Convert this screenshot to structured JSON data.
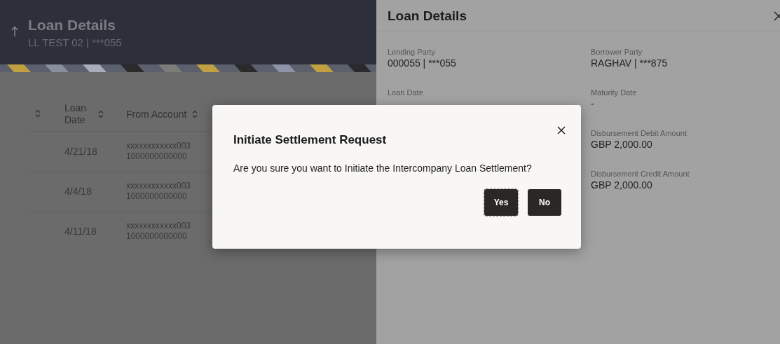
{
  "left_page": {
    "title": "Loan Details",
    "subtitle": "LL TEST 02 | ***055",
    "table": {
      "columns": [
        {
          "label": "Loan Date"
        },
        {
          "label": "From Account"
        }
      ],
      "rows": [
        {
          "loan_date": "4/21/18",
          "from_account": [
            "xxxxxxxxxxxx003",
            "1000000000000"
          ]
        },
        {
          "loan_date": "4/4/18",
          "from_account": [
            "xxxxxxxxxxxx003",
            "1000000000000"
          ]
        },
        {
          "loan_date": "4/11/18",
          "from_account": [
            "xxxxxxxxxxxx003",
            "1000000000000"
          ]
        }
      ]
    }
  },
  "detail_panel": {
    "title": "Loan Details",
    "columns": [
      [
        {
          "label": "Lending Party",
          "value": "000055 | ***055"
        },
        {
          "label": "Loan Date"
        }
      ],
      [
        {
          "label": "Borrower Party",
          "value": "RAGHAV | ***875"
        },
        {
          "label": "Maturity Date",
          "value": "-"
        },
        {
          "label": "Disbursement Debit Amount",
          "value": "GBP 2,000.00"
        },
        {
          "label": "Disbursement Credit Amount",
          "value": "GBP 2,000.00"
        }
      ]
    ]
  },
  "dialog": {
    "title": "Initiate Settlement Request",
    "message": "Are you sure you want to Initiate the Intercompany Loan Settlement?",
    "buttons": [
      {
        "label": "Yes",
        "focused": true
      },
      {
        "label": "No",
        "focused": false
      }
    ]
  }
}
